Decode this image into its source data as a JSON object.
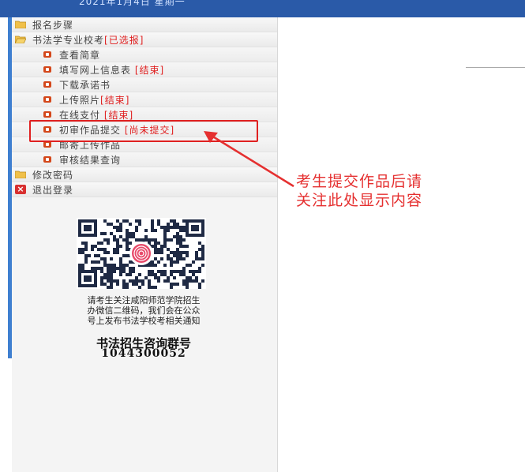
{
  "header": {
    "date_text": "2021年1月4日 星期一"
  },
  "menu": {
    "items": [
      {
        "label": "报名步骤",
        "status": ""
      },
      {
        "label": "书法学专业校考",
        "status": "[已选报]"
      },
      {
        "label": "查看简章",
        "status": ""
      },
      {
        "label": "填写网上信息表",
        "status": "[结束]"
      },
      {
        "label": "下载承诺书",
        "status": ""
      },
      {
        "label": "上传照片",
        "status": "[结束]"
      },
      {
        "label": "在线支付",
        "status": "[结束]"
      },
      {
        "label": "初审作品提交",
        "status": "[尚未提交]"
      },
      {
        "label": "邮寄上传作品",
        "status": ""
      },
      {
        "label": "审核结果查询",
        "status": ""
      },
      {
        "label": "修改密码",
        "status": ""
      },
      {
        "label": "退出登录",
        "status": ""
      }
    ]
  },
  "annotation": {
    "line1": "考生提交作品后请",
    "line2": "关注此处显示内容"
  },
  "notice": {
    "line1": "请考生关注咸阳师范学院招生",
    "line2": "办微信二维码，我们会在公众",
    "line3": "号上发布书法学校考相关通知"
  },
  "group": {
    "title": "书法招生咨询群号",
    "number": "1044300052"
  },
  "colors": {
    "accent": "#2a5aa8",
    "highlight": "#e02020",
    "annotation": "#e53030"
  },
  "icons": {
    "folder": "folder-icon",
    "bullet": "bullet-icon",
    "logout": "close-icon",
    "qr": "qr-code"
  }
}
